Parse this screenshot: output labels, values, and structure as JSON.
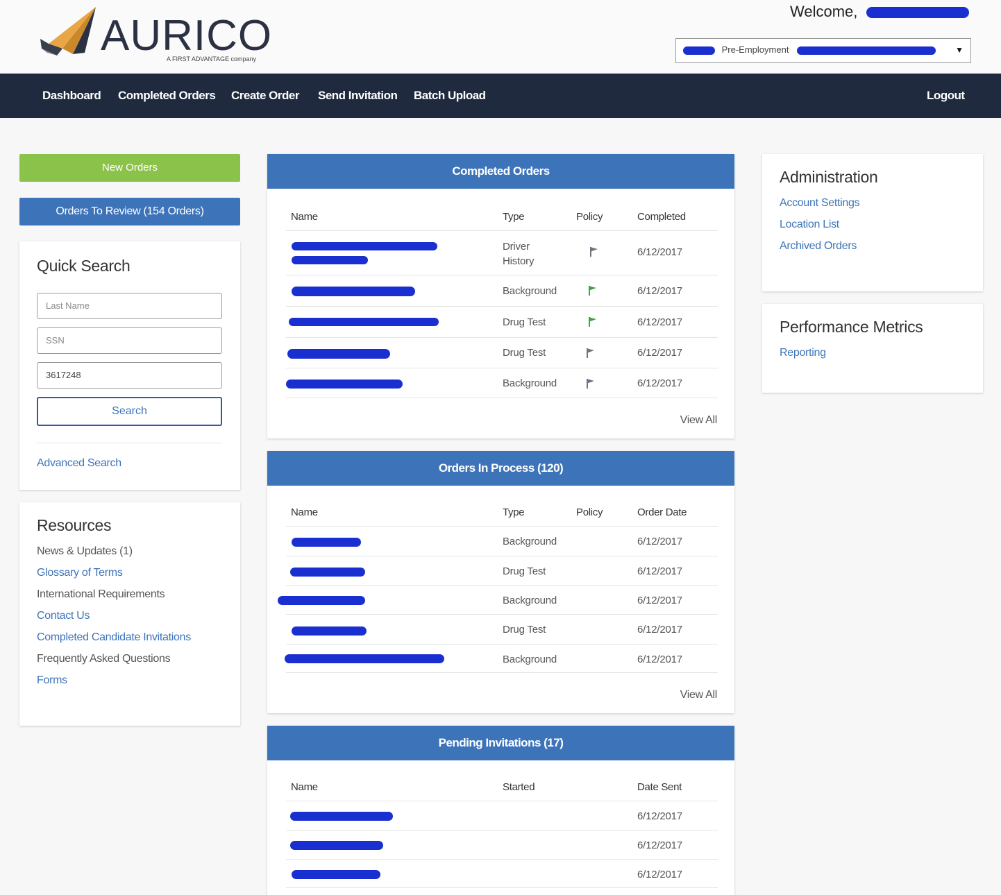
{
  "header": {
    "brand": "AURICO",
    "brand_tagline": "A FIRST ADVANTAGE company",
    "welcome": "Welcome,",
    "account_select": "Pre-Employment"
  },
  "nav": {
    "items": [
      "Dashboard",
      "Completed Orders",
      "Create Order",
      "Send Invitation",
      "Batch Upload"
    ],
    "logout": "Logout"
  },
  "left": {
    "new_orders": "New Orders",
    "orders_to_review": "Orders To Review  (154 Orders)",
    "quick_search": {
      "title": "Quick Search",
      "last_name_placeholder": "Last Name",
      "ssn_placeholder": "SSN",
      "order_value": "3617248",
      "search_button": "Search",
      "advanced": "Advanced Search"
    },
    "resources": {
      "title": "Resources",
      "items": [
        "News & Updates (1)",
        "Glossary of Terms",
        "International Requirements",
        "Contact Us",
        "Completed Candidate Invitations",
        "Frequently Asked Questions",
        "Forms"
      ]
    }
  },
  "completed": {
    "title": "Completed Orders",
    "headers": [
      "Name",
      "Type",
      "Policy",
      "Completed"
    ],
    "rows": [
      {
        "type": "Driver History",
        "policy": "gray",
        "date": "6/12/2017"
      },
      {
        "type": "Background",
        "policy": "green",
        "date": "6/12/2017"
      },
      {
        "type": "Drug Test",
        "policy": "green",
        "date": "6/12/2017"
      },
      {
        "type": "Drug Test",
        "policy": "gray",
        "date": "6/12/2017"
      },
      {
        "type": "Background",
        "policy": "gray",
        "date": "6/12/2017"
      }
    ],
    "view_all": "View All"
  },
  "in_process": {
    "title": "Orders In Process (120)",
    "headers": [
      "Name",
      "Type",
      "Policy",
      "Order Date"
    ],
    "rows": [
      {
        "type": "Background",
        "date": "6/12/2017"
      },
      {
        "type": "Drug Test",
        "date": "6/12/2017"
      },
      {
        "type": "Background",
        "date": "6/12/2017"
      },
      {
        "type": "Drug Test",
        "date": "6/12/2017"
      },
      {
        "type": "Background",
        "date": "6/12/2017"
      }
    ],
    "view_all": "View All"
  },
  "pending": {
    "title": "Pending Invitations (17)",
    "headers": [
      "Name",
      "Started",
      "Date Sent"
    ],
    "rows": [
      {
        "date": "6/12/2017"
      },
      {
        "date": "6/12/2017"
      },
      {
        "date": "6/12/2017"
      }
    ]
  },
  "admin": {
    "title": "Administration",
    "items": [
      "Account Settings",
      "Location List",
      "Archived Orders"
    ]
  },
  "metrics": {
    "title": "Performance Metrics",
    "items": [
      "Reporting"
    ]
  },
  "colors": {
    "nav_bg": "#1f2a3f",
    "accent_blue": "#3d74b9",
    "accent_green": "#8bc34a",
    "redaction": "#1a2fd0"
  }
}
